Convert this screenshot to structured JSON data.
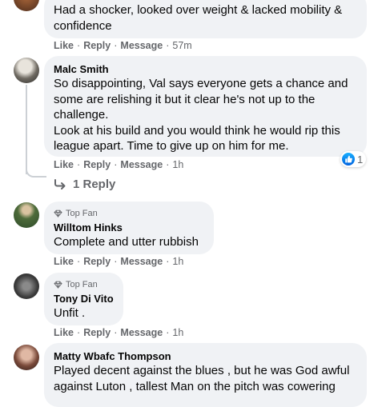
{
  "comments": [
    {
      "text": "Had a shocker, looked over weight & lacked mobility & confidence",
      "actions": {
        "like": "Like",
        "reply": "Reply",
        "message": "Message",
        "time": "57m"
      }
    },
    {
      "name": "Malc Smith",
      "text": "So disappointing, Val says everyone gets a chance and some are relishing it but it clear he's not up to the challenge.\nLook at his build and you would think he would rip this league apart. Time to give up on him for me.",
      "reaction_count": "1",
      "actions": {
        "like": "Like",
        "reply": "Reply",
        "message": "Message",
        "time": "1h"
      },
      "replies_label": "1 Reply"
    },
    {
      "badge": "Top Fan",
      "name": "Willtom Hinks",
      "text": "Complete and utter rubbish",
      "actions": {
        "like": "Like",
        "reply": "Reply",
        "message": "Message",
        "time": "1h"
      }
    },
    {
      "badge": "Top Fan",
      "name": "Tony Di Vito",
      "text": "Unfit .",
      "actions": {
        "like": "Like",
        "reply": "Reply",
        "message": "Message",
        "time": "1h"
      }
    },
    {
      "name": "Matty Wbafc Thompson",
      "text": "Played decent against the blues , but he was God awful against Luton , tallest Man on the pitch was cowering"
    }
  ],
  "colors": {
    "bubble": "#f0f2f5",
    "meta": "#65676b",
    "like_blue": "#1877f2"
  },
  "icons": {
    "reply_arrow": "reply-arrow-icon",
    "top_fan": "diamond-icon",
    "reaction": "like-icon"
  }
}
